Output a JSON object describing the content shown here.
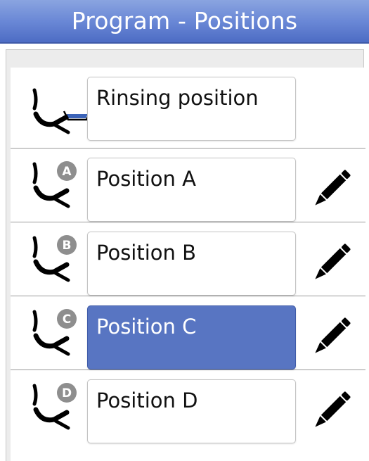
{
  "header": {
    "title": "Program - Positions"
  },
  "positions": [
    {
      "label": "Rinsing position",
      "icon": "chair-rinse-icon",
      "editable": false,
      "selected": false
    },
    {
      "label": "Position A",
      "badge": "A",
      "icon": "chair-position-a-icon",
      "editable": true,
      "selected": false
    },
    {
      "label": "Position B",
      "badge": "B",
      "icon": "chair-position-b-icon",
      "editable": true,
      "selected": false
    },
    {
      "label": "Position C",
      "badge": "C",
      "icon": "chair-position-c-icon",
      "editable": true,
      "selected": true
    },
    {
      "label": "Position D",
      "badge": "D",
      "icon": "chair-position-d-icon",
      "editable": true,
      "selected": false
    }
  ],
  "colors": {
    "title_bar": "#6a88d6",
    "selected_field": "#5875c2",
    "badge": "#8e8e8e",
    "basin_water": "#3b63b8"
  }
}
